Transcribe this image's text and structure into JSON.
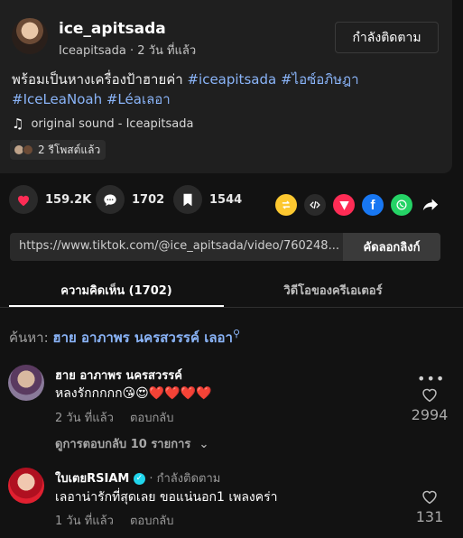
{
  "post": {
    "username": "ice_apitsada",
    "display_meta": "Iceapitsada · 2 วัน ที่แล้ว",
    "follow_label": "กำลังติดตาม",
    "caption_text": "พร้อมเป็นหางเครื่องป้าฮายค่า ",
    "hashtags": [
      "#iceapitsada",
      "#ไอซ์อภิษฎา",
      "#IceLeaNoah",
      "#Léaเลอา"
    ],
    "sound": "original sound - Iceapitsada",
    "repost_label": "2 รีโพสต์แล้ว"
  },
  "actions": {
    "likes": "159.2K",
    "comments": "1702",
    "saves": "1544"
  },
  "link": {
    "url": "https://www.tiktok.com/@ice_apitsada/video/760248...",
    "copy_label": "คัดลอกลิงก์"
  },
  "tabs": {
    "comments": "ความคิดเห็น (1702)",
    "creator_videos": "วิดีโอของครีเอเตอร์"
  },
  "search": {
    "prefix": "ค้นหา: ",
    "query": "ฮาย อาภาพร นครสวรรค์ เลอา"
  },
  "comments": [
    {
      "author": "ฮาย อาภาพร นครสวรรค์",
      "text": "หลงรักกกกก😘😍❤️❤️❤️❤️",
      "time": "2 วัน ที่แล้ว",
      "reply": "ตอบกลับ",
      "likes": "2994",
      "more_replies": "ดูการตอบกลับ 10 รายการ"
    },
    {
      "author": "ใบเตยRSIAM",
      "follow_tag": "· กำลังติดตาม",
      "text": "เลอาน่ารักที่สุดเลย ขอแน่นอก1 เพลงคร่า",
      "time": "1 วัน ที่แล้ว",
      "reply": "ตอบกลับ",
      "likes": "131"
    }
  ],
  "colors": {
    "accent_link": "#8ab4f8",
    "like_heart": "#fe2c55",
    "share_yellow": "#fdc830",
    "share_red": "#fe2c55",
    "share_facebook": "#1877f2",
    "share_whatsapp": "#25d366"
  }
}
